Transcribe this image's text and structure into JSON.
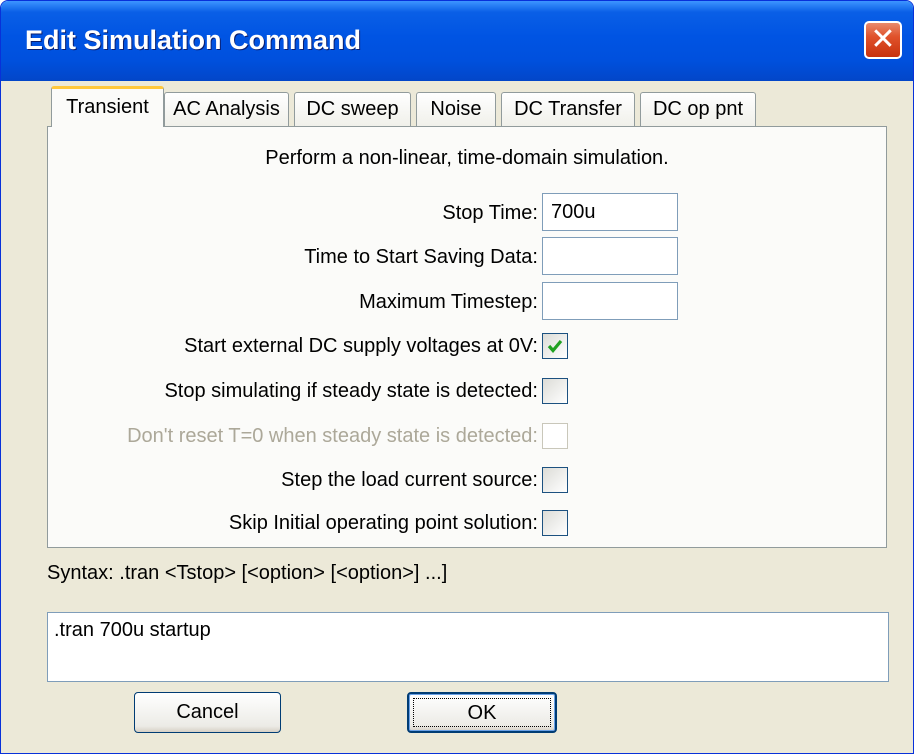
{
  "window": {
    "title": "Edit Simulation Command",
    "close_symbol": "✕"
  },
  "tabs": [
    {
      "label": "Transient",
      "active": true
    },
    {
      "label": "AC Analysis"
    },
    {
      "label": "DC sweep"
    },
    {
      "label": "Noise"
    },
    {
      "label": "DC Transfer"
    },
    {
      "label": "DC op pnt"
    }
  ],
  "transient": {
    "description": "Perform a non-linear, time-domain simulation.",
    "stop_time": {
      "label": "Stop Time:",
      "value": "700u"
    },
    "start_saving": {
      "label": "Time to Start Saving Data:",
      "value": ""
    },
    "max_timestep": {
      "label": "Maximum Timestep:",
      "value": ""
    },
    "options": [
      {
        "label": "Start external DC supply voltages at 0V:",
        "checked": true,
        "enabled": true
      },
      {
        "label": "Stop simulating if steady state is detected:",
        "checked": false,
        "enabled": true
      },
      {
        "label": "Don't reset T=0 when steady state is detected:",
        "checked": false,
        "enabled": false
      },
      {
        "label": "Step the load current source:",
        "checked": false,
        "enabled": true
      },
      {
        "label": "Skip Initial operating point solution:",
        "checked": false,
        "enabled": true
      }
    ]
  },
  "syntax": "Syntax:  .tran <Tstop> [<option> [<option>] ...]",
  "command_text": ".tran 700u startup",
  "buttons": {
    "cancel": "Cancel",
    "ok": "OK"
  },
  "colors": {
    "titlebar": "#0054e3",
    "dialog_bg": "#ece9d8",
    "active_tab_accent": "#ffc83c",
    "checkmark": "#21a121",
    "disabled_text": "#aca899"
  }
}
